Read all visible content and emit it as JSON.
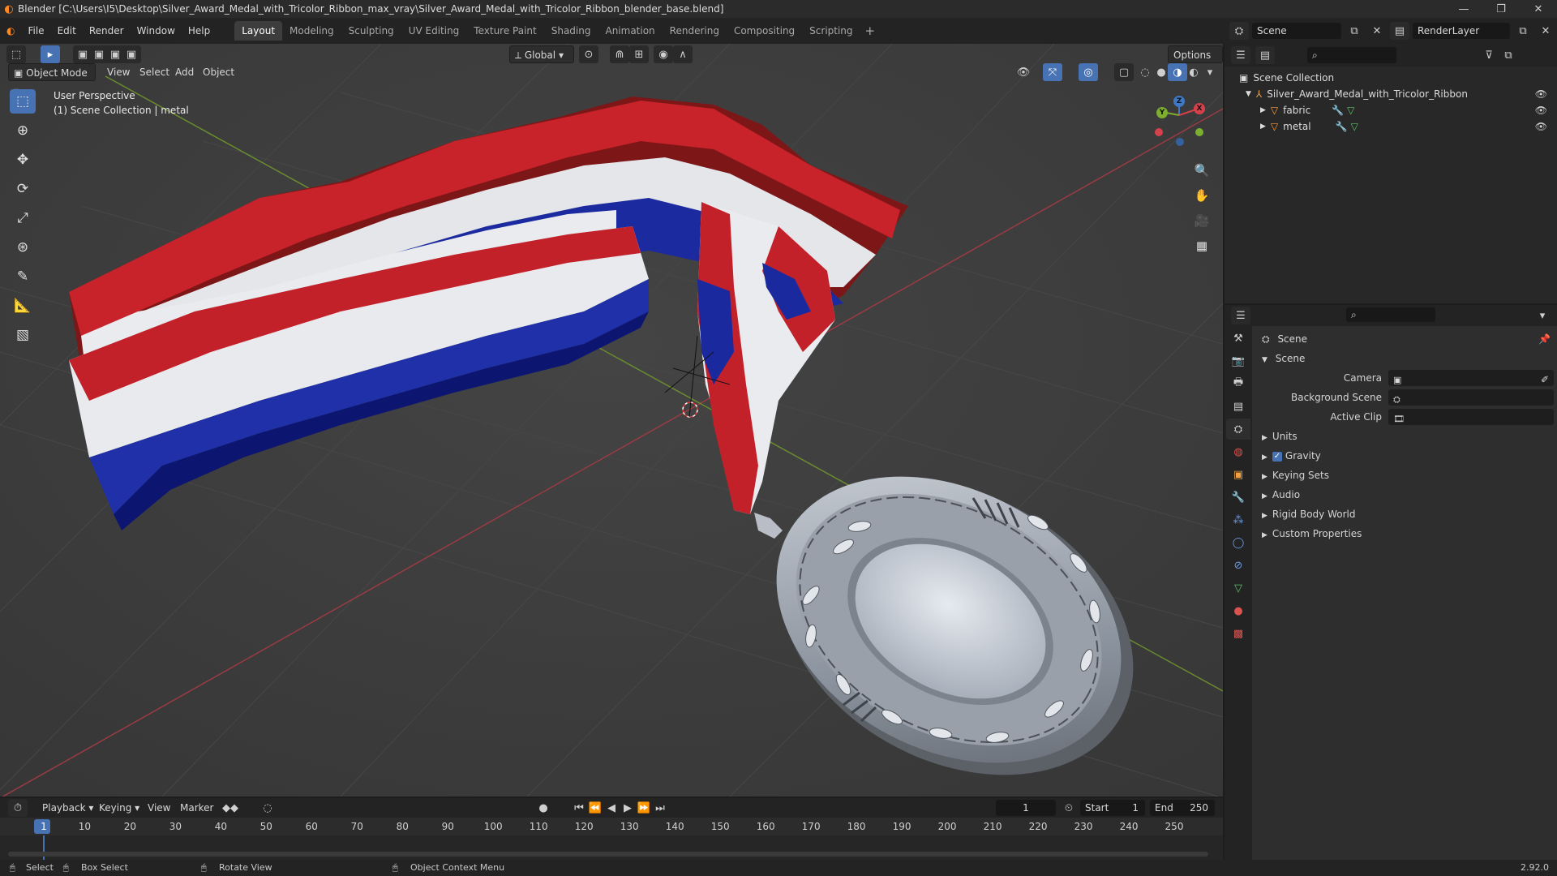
{
  "app": {
    "title": "Blender [C:\\Users\\I5\\Desktop\\Silver_Award_Medal_with_Tricolor_Ribbon_max_vray\\Silver_Award_Medal_with_Tricolor_Ribbon_blender_base.blend]",
    "version": "2.92.0"
  },
  "menu": [
    "File",
    "Edit",
    "Render",
    "Window",
    "Help"
  ],
  "workspaces": [
    "Layout",
    "Modeling",
    "Sculpting",
    "UV Editing",
    "Texture Paint",
    "Shading",
    "Animation",
    "Rendering",
    "Compositing",
    "Scripting"
  ],
  "active_workspace": "Layout",
  "scene_selector": {
    "scene": "Scene",
    "view_layer": "RenderLayer"
  },
  "viewport": {
    "orientation": "Global",
    "options_label": "Options",
    "mode": "Object Mode",
    "menus": [
      "View",
      "Select",
      "Add",
      "Object"
    ],
    "info_line1": "User Perspective",
    "info_line2": "(1) Scene Collection | metal"
  },
  "gizmo": {
    "x": "X",
    "y": "Y",
    "z": "Z"
  },
  "outliner": {
    "root": "Scene Collection",
    "collection": "Silver_Award_Medal_with_Tricolor_Ribbon",
    "objects": [
      "fabric",
      "metal"
    ]
  },
  "properties": {
    "context": "Scene",
    "panel": "Scene",
    "fields": {
      "camera": "Camera",
      "background_scene": "Background Scene",
      "active_clip": "Active Clip"
    },
    "subpanels": [
      "Units",
      "Gravity",
      "Keying Sets",
      "Audio",
      "Rigid Body World",
      "Custom Properties"
    ]
  },
  "timeline": {
    "menus": [
      "Playback",
      "Keying",
      "View",
      "Marker"
    ],
    "current_frame": "1",
    "start_label": "Start",
    "start": "1",
    "end_label": "End",
    "end": "250",
    "ticks": [
      "1",
      "10",
      "20",
      "30",
      "40",
      "50",
      "60",
      "70",
      "80",
      "90",
      "100",
      "110",
      "120",
      "130",
      "140",
      "150",
      "160",
      "170",
      "180",
      "190",
      "200",
      "210",
      "220",
      "230",
      "240",
      "250"
    ]
  },
  "status": {
    "select": "Select",
    "box_select": "Box Select",
    "rotate_view": "Rotate View",
    "context_menu": "Object Context Menu"
  }
}
